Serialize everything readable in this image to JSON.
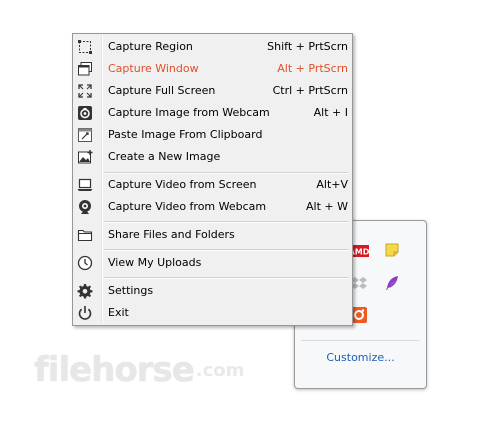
{
  "menu": {
    "items": [
      {
        "label": "Capture Region",
        "shortcut": "Shift + PrtScrn",
        "icon": "region-select-icon"
      },
      {
        "label": "Capture Window",
        "shortcut": "Alt + PrtScrn",
        "icon": "window-icon"
      },
      {
        "label": "Capture Full Screen",
        "shortcut": "Ctrl + PrtScrn",
        "icon": "fullscreen-icon"
      },
      {
        "label": "Capture Image from Webcam",
        "shortcut": "Alt + I",
        "icon": "webcam-image-icon"
      },
      {
        "label": "Paste Image From Clipboard",
        "shortcut": "",
        "icon": "clipboard-icon"
      },
      {
        "label": "Create a New Image",
        "shortcut": "",
        "icon": "new-image-icon"
      },
      {
        "label": "Capture Video from Screen",
        "shortcut": "Alt+V",
        "icon": "screen-video-icon"
      },
      {
        "label": "Capture Video from Webcam",
        "shortcut": "Alt + W",
        "icon": "webcam-video-icon"
      },
      {
        "label": "Share Files and Folders",
        "shortcut": "",
        "icon": "folder-icon"
      },
      {
        "label": "View My Uploads",
        "shortcut": "",
        "icon": "clock-icon"
      },
      {
        "label": "Settings",
        "shortcut": "",
        "icon": "gear-icon"
      },
      {
        "label": "Exit",
        "shortcut": "",
        "icon": "power-icon"
      }
    ],
    "active_index": 1,
    "accent_color": "#e0502a"
  },
  "tray": {
    "customize_label": "Customize...",
    "icons": [
      "amd-icon",
      "sticky-note-icon",
      "dropbox-icon",
      "feather-icon",
      "orange-capture-icon"
    ]
  },
  "watermark": {
    "text": "filehorse",
    "suffix": ".com"
  }
}
